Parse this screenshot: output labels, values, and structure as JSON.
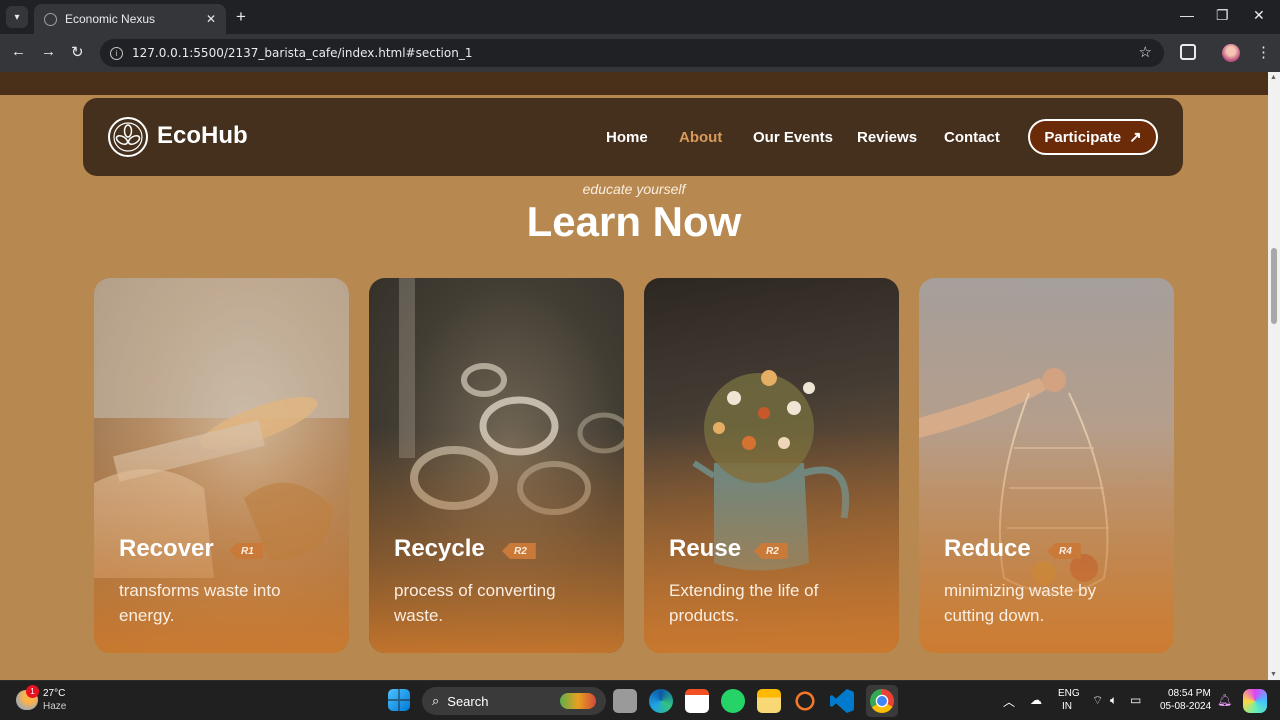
{
  "browser": {
    "tab_title": "Economic Nexus",
    "url": "127.0.0.1:5500/2137_barista_cafe/index.html#section_1"
  },
  "site": {
    "brand": "EcoHub",
    "nav": [
      {
        "label": "Home",
        "active": false
      },
      {
        "label": "About",
        "active": true
      },
      {
        "label": "Our Events",
        "active": false
      },
      {
        "label": "Reviews",
        "active": false
      },
      {
        "label": "Contact",
        "active": false
      }
    ],
    "cta_label": "Participate",
    "accent_color": "#d99a5c",
    "header_color": "#44301c",
    "page_color": "#b7884f"
  },
  "section": {
    "eyebrow": "educate yourself",
    "title": "Learn Now",
    "cards": [
      {
        "name": "Recover",
        "badge": "R1",
        "description": "transforms waste into energy."
      },
      {
        "name": "Recycle",
        "badge": "R2",
        "description": "process of converting waste."
      },
      {
        "name": "Reuse",
        "badge": "R2",
        "description": "Extending the life of products."
      },
      {
        "name": "Reduce",
        "badge": "R4",
        "description": "minimizing waste by cutting down."
      }
    ]
  },
  "taskbar": {
    "weather_temp": "27°C",
    "weather_desc": "Haze",
    "weather_badge": "1",
    "search_label": "Search",
    "lang_line1": "ENG",
    "lang_line2": "IN",
    "time": "08:54 PM",
    "date": "05-08-2024"
  }
}
